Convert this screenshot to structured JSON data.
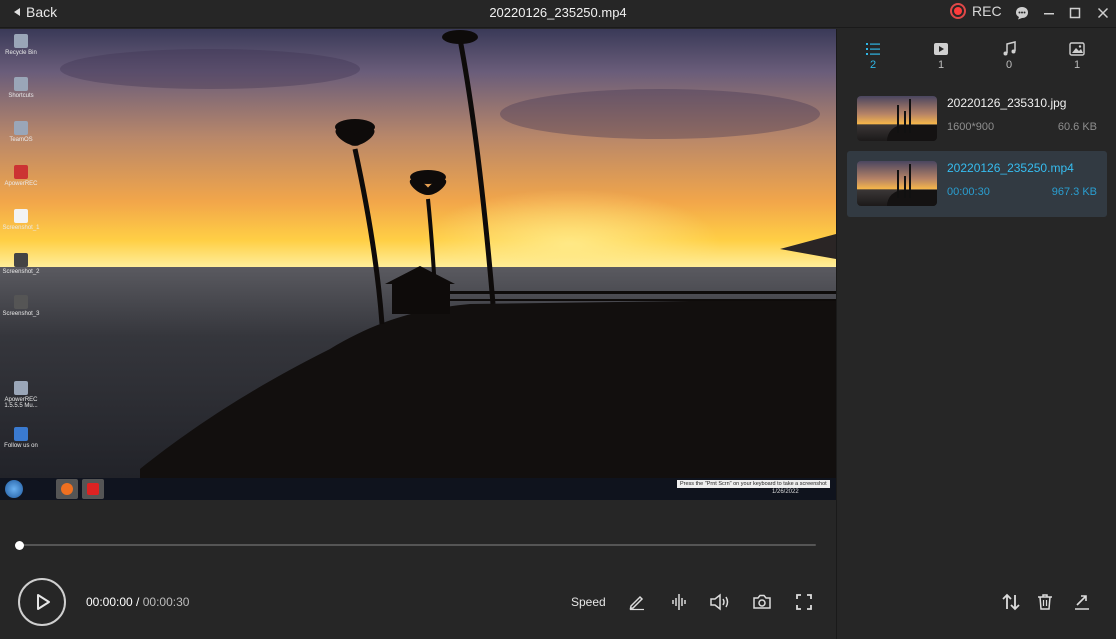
{
  "window": {
    "back_label": "Back",
    "title": "20220126_235250.mp4",
    "rec_label": "REC"
  },
  "video": {
    "desktop_icons": [
      "Recycle Bin",
      "Shortcuts",
      "TeamOS",
      "ApowerREC",
      "Screenshot_1",
      "Screenshot_2",
      "Screenshot_3",
      "ApowerREC 1.5.5.5 Mu...",
      "Follow us on"
    ],
    "tooltip": "Press the \"Prnt Scrn\" on your keyboard to take a screenshot",
    "taskbar_date": "1/26/2022"
  },
  "player": {
    "current_time": "00:00:00",
    "separator": " / ",
    "total_time": "00:00:30",
    "speed_label": "Speed",
    "progress": 0
  },
  "panel": {
    "tabs": [
      {
        "icon": "list-icon",
        "count": "2",
        "active": true
      },
      {
        "icon": "video-icon",
        "count": "1",
        "active": false
      },
      {
        "icon": "music-icon",
        "count": "0",
        "active": false
      },
      {
        "icon": "image-icon",
        "count": "1",
        "active": false
      }
    ],
    "files": [
      {
        "name": "20220126_235310.jpg",
        "meta": "1600*900",
        "size": "60.6 KB",
        "selected": false
      },
      {
        "name": "20220126_235250.mp4",
        "meta": "00:00:30",
        "size": "967.3 KB",
        "selected": true
      }
    ]
  },
  "colors": {
    "accent": "#2fb7e6",
    "background": "#262626",
    "rec_red": "#ff3b3b"
  }
}
